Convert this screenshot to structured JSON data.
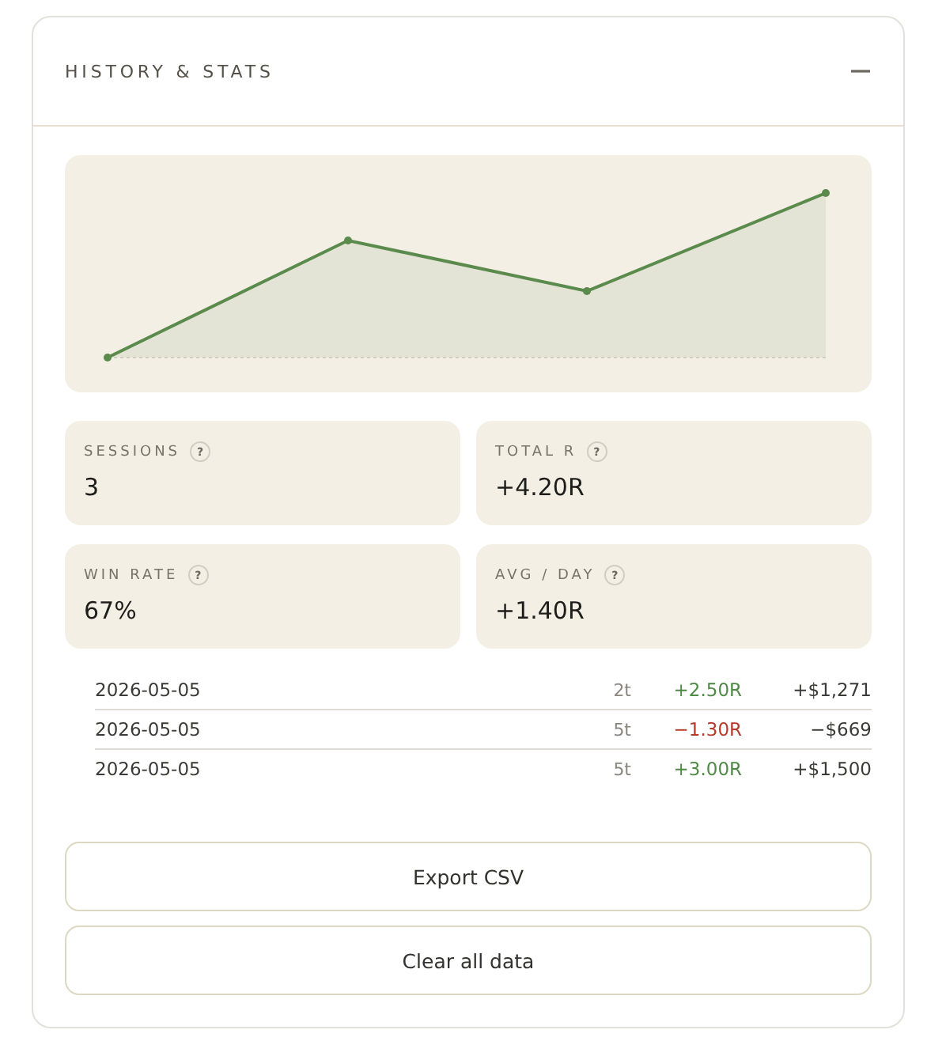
{
  "panel": {
    "title": "HISTORY & STATS",
    "expanded": true
  },
  "stats": [
    {
      "label": "SESSIONS",
      "help": "?",
      "value": "3"
    },
    {
      "label": "TOTAL R",
      "help": "?",
      "value": "+4.20R"
    },
    {
      "label": "WIN RATE",
      "help": "?",
      "value": "67%"
    },
    {
      "label": "AVG / DAY",
      "help": "?",
      "value": "+1.40R"
    }
  ],
  "sessions": [
    {
      "date": "2026-05-05",
      "trades": "2t",
      "r": "+2.50R",
      "kind": "gain",
      "pnl": "+$1,271"
    },
    {
      "date": "2026-05-05",
      "trades": "5t",
      "r": "−1.30R",
      "kind": "loss",
      "pnl": "−$669"
    },
    {
      "date": "2026-05-05",
      "trades": "5t",
      "r": "+3.00R",
      "kind": "gain",
      "pnl": "+$1,500"
    }
  ],
  "buttons": [
    "Export CSV",
    "Clear all data"
  ]
}
